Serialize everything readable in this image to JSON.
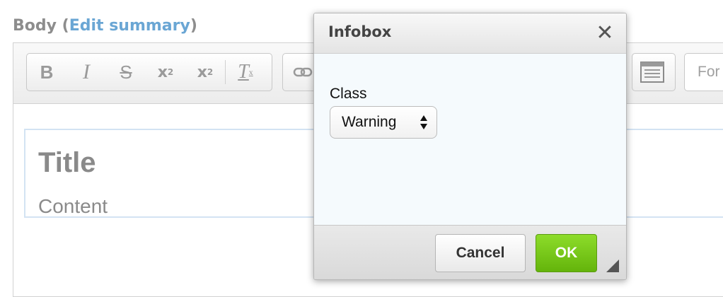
{
  "field": {
    "label": "Body",
    "paren_open": " (",
    "link": "Edit summary",
    "paren_close": ")"
  },
  "toolbar": {
    "bold": "B",
    "italic": "I",
    "strike": "S",
    "superscript": "x",
    "superscript_mark": "2",
    "subscript": "x",
    "subscript_mark": "2",
    "remove_format": "T",
    "remove_format_mark": "x",
    "format_placeholder": "For"
  },
  "content": {
    "title": "Title",
    "body": "Content"
  },
  "dialog": {
    "title": "Infobox",
    "close_glyph": "✕",
    "class_label": "Class",
    "class_value": "Warning",
    "cancel_label": "Cancel",
    "ok_label": "OK"
  },
  "colors": {
    "link": "#6aa6d4",
    "ok_button": "#64b40b",
    "dialog_body": "#f5fafd"
  }
}
